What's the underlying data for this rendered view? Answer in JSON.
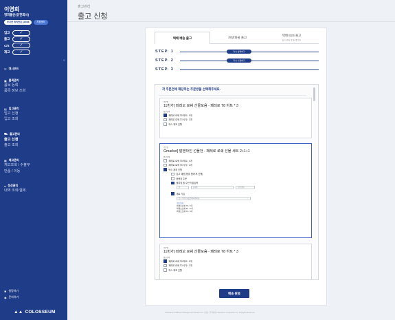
{
  "user": {
    "name": "이영희",
    "company": "영희물산(유한회사)",
    "badge_text": "무기한 취직번호 [35/58",
    "badge_action": "지원센터"
  },
  "quick": [
    {
      "label": "입고"
    },
    {
      "label": "출고"
    },
    {
      "label": "C/S"
    },
    {
      "label": "재고"
    }
  ],
  "sidebar": {
    "collapse_icon": "«",
    "dashboard": "대시보드",
    "product": {
      "title": "품목관리",
      "items": [
        "품목 등록",
        "품목 정보 조회"
      ]
    },
    "inbound": {
      "title": "입고관리",
      "items": [
        "입고 신청",
        "입고 조회"
      ]
    },
    "outbound": {
      "title": "출고관리",
      "items": [
        "출고 신청",
        "출고 조회"
      ]
    },
    "stock": {
      "title": "재고관리",
      "items": [
        "재고조회 / 수불부",
        "반품 / 이동"
      ]
    },
    "settle": {
      "title": "정산관리",
      "items": [
        "내역 조회/결제"
      ]
    },
    "settings": "설정하기",
    "help": "문의하기",
    "logo": "COLOSSEUM"
  },
  "page": {
    "breadcrumb": "출고관리",
    "title": "출고 신청"
  },
  "tabs": [
    {
      "label": "택배 배송 출고",
      "sub": ""
    },
    {
      "label": "차량/화물 출고",
      "sub": ""
    },
    {
      "label": "택배 B2B 출고",
      "sub": "출고요청서 및 물류를 업무"
    }
  ],
  "steps": [
    {
      "label": "STEP. 1",
      "pill": "다시 선택하기"
    },
    {
      "label": "STEP. 2",
      "pill": "다시 수정하기"
    },
    {
      "label": "STEP. 3",
      "pill": ""
    }
  ],
  "list": {
    "instruction": "각 주문건에 해당하는 주문방을 선택해주세요.",
    "item_tag": "주문명",
    "option_tag": "옵션선택",
    "items": [
      {
        "name": "11번가] 퍼레오 로쉐 선물모음 - 페레로 T8 하트 * 3",
        "options": [
          {
            "label": "페레로 로쉐 T8 하트 / 5개",
            "checked": true
          },
          {
            "label": "페레로 로쉐 T3 사각 / 3개",
            "checked": false
          },
          {
            "label": "박스 재포 진행",
            "checked": false
          }
        ]
      },
      {
        "name": "Gmarket] 발렌타인 선물전 - 페레로 로쉐 선물 세트 2+1+1",
        "options": [
          {
            "label": "페레로 로쉐 T8 하트 / 4개",
            "checked": false
          },
          {
            "label": "페레로 로쉐 T8 사각 / 2개",
            "checked": false
          },
          {
            "label": "박스 재포 진행",
            "checked": true
          }
        ],
        "sub_options": [
          {
            "label": "입고 예정 (합류 함께 후 진행)",
            "checked": false
          },
          {
            "label": "동봉된 주문",
            "checked": false
          },
          {
            "label": "물류창 을 수반 직접입력",
            "checked": true
          }
        ],
        "inputs": [
          "입",
          "상세주",
          "수량 입력"
        ],
        "address_label": "새로 기입",
        "address_placeholder": "입고 주문번호를 입력해주세요.",
        "address_tag": "수량 출력",
        "address_list": [
          "페레로로쉐 T8 / 2개",
          "페레로로쉐 E3 / 1개",
          "페레로로쉐 F4 / 1개"
        ]
      },
      {
        "name": "11번가] 퍼레오 로쉐 선물모음 - 페레로 T8 하트 * 3",
        "options": [
          {
            "label": "페레로 로쉐 T8 하트 / 5개",
            "checked": true
          },
          {
            "label": "페레로 로쉐 T3 사각 / 3개",
            "checked": false
          },
          {
            "label": "박스 재포 진행",
            "checked": false
          }
        ]
      }
    ]
  },
  "save_label": "배송 완료",
  "footer": "Colosseum Fulfillment Management Solution Inc. | 대표: 주식회사 Colosseum Corporation Inc. All Rights Reserved",
  "colors": {
    "primary": "#1f3c88",
    "accent": "#3d63c7",
    "background": "#eef1f6"
  }
}
